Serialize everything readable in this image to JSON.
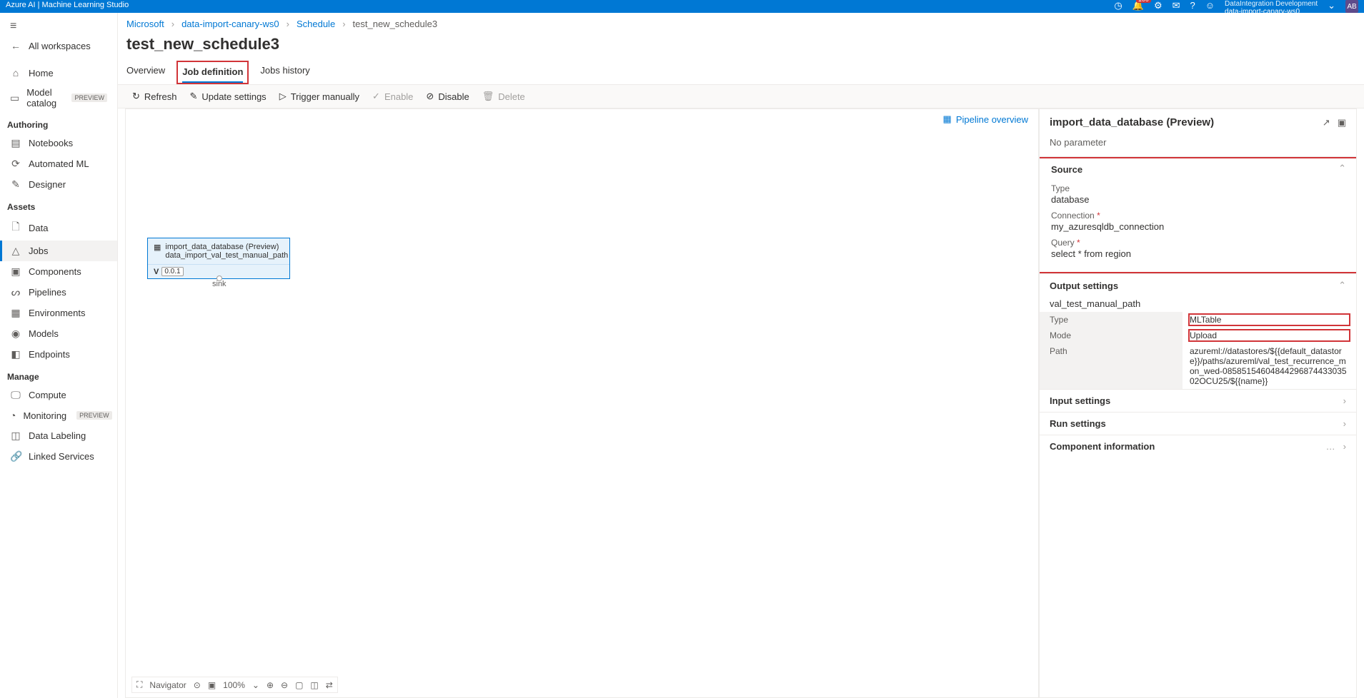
{
  "topbar": {
    "title": "Azure AI | Machine Learning Studio",
    "notif_count": "100",
    "workspace_group": "DataIntegration Development",
    "workspace_name": "data-import-canary-ws0",
    "avatar": "AB"
  },
  "sidebar": {
    "all_workspaces": "All workspaces",
    "home": "Home",
    "model_catalog": "Model catalog",
    "preview": "PREVIEW",
    "sections": {
      "authoring": "Authoring",
      "assets": "Assets",
      "manage": "Manage"
    },
    "authoring": {
      "notebooks": "Notebooks",
      "automl": "Automated ML",
      "designer": "Designer"
    },
    "assets": {
      "data": "Data",
      "jobs": "Jobs",
      "components": "Components",
      "pipelines": "Pipelines",
      "environments": "Environments",
      "models": "Models",
      "endpoints": "Endpoints"
    },
    "manage": {
      "compute": "Compute",
      "monitoring": "Monitoring",
      "data_labeling": "Data Labeling",
      "linked_services": "Linked Services"
    }
  },
  "breadcrumb": {
    "c0": "Microsoft",
    "c1": "data-import-canary-ws0",
    "c2": "Schedule",
    "c3": "test_new_schedule3"
  },
  "page_title": "test_new_schedule3",
  "tabs": {
    "overview": "Overview",
    "job_definition": "Job definition",
    "jobs_history": "Jobs history"
  },
  "toolbar": {
    "refresh": "Refresh",
    "update": "Update settings",
    "trigger": "Trigger manually",
    "enable": "Enable",
    "disable": "Disable",
    "delete": "Delete"
  },
  "pipeline_overview": "Pipeline overview",
  "node": {
    "title": "import_data_database (Preview)",
    "subtitle": "data_import_val_test_manual_path",
    "version": "0.0.1",
    "version_prefix": "V",
    "sink": "sink"
  },
  "canvas_footer": {
    "navigator": "Navigator",
    "zoom": "100%"
  },
  "details": {
    "title": "import_data_database (Preview)",
    "no_parameter": "No parameter",
    "source": {
      "header": "Source",
      "type_label": "Type",
      "type_value": "database",
      "connection_label": "Connection",
      "connection_value": "my_azuresqldb_connection",
      "query_label": "Query",
      "query_value": "select * from region"
    },
    "output": {
      "header": "Output settings",
      "name": "val_test_manual_path",
      "type_label": "Type",
      "type_value": "MLTable",
      "mode_label": "Mode",
      "mode_value": "Upload",
      "path_label": "Path",
      "path_value": "azureml://datastores/${{default_datastore}}/paths/azureml/val_test_recurrence_mon_wed-0858515460484429687443303502OCU25/${{name}}"
    },
    "input_settings": "Input settings",
    "run_settings": "Run settings",
    "component_info": "Component information"
  }
}
